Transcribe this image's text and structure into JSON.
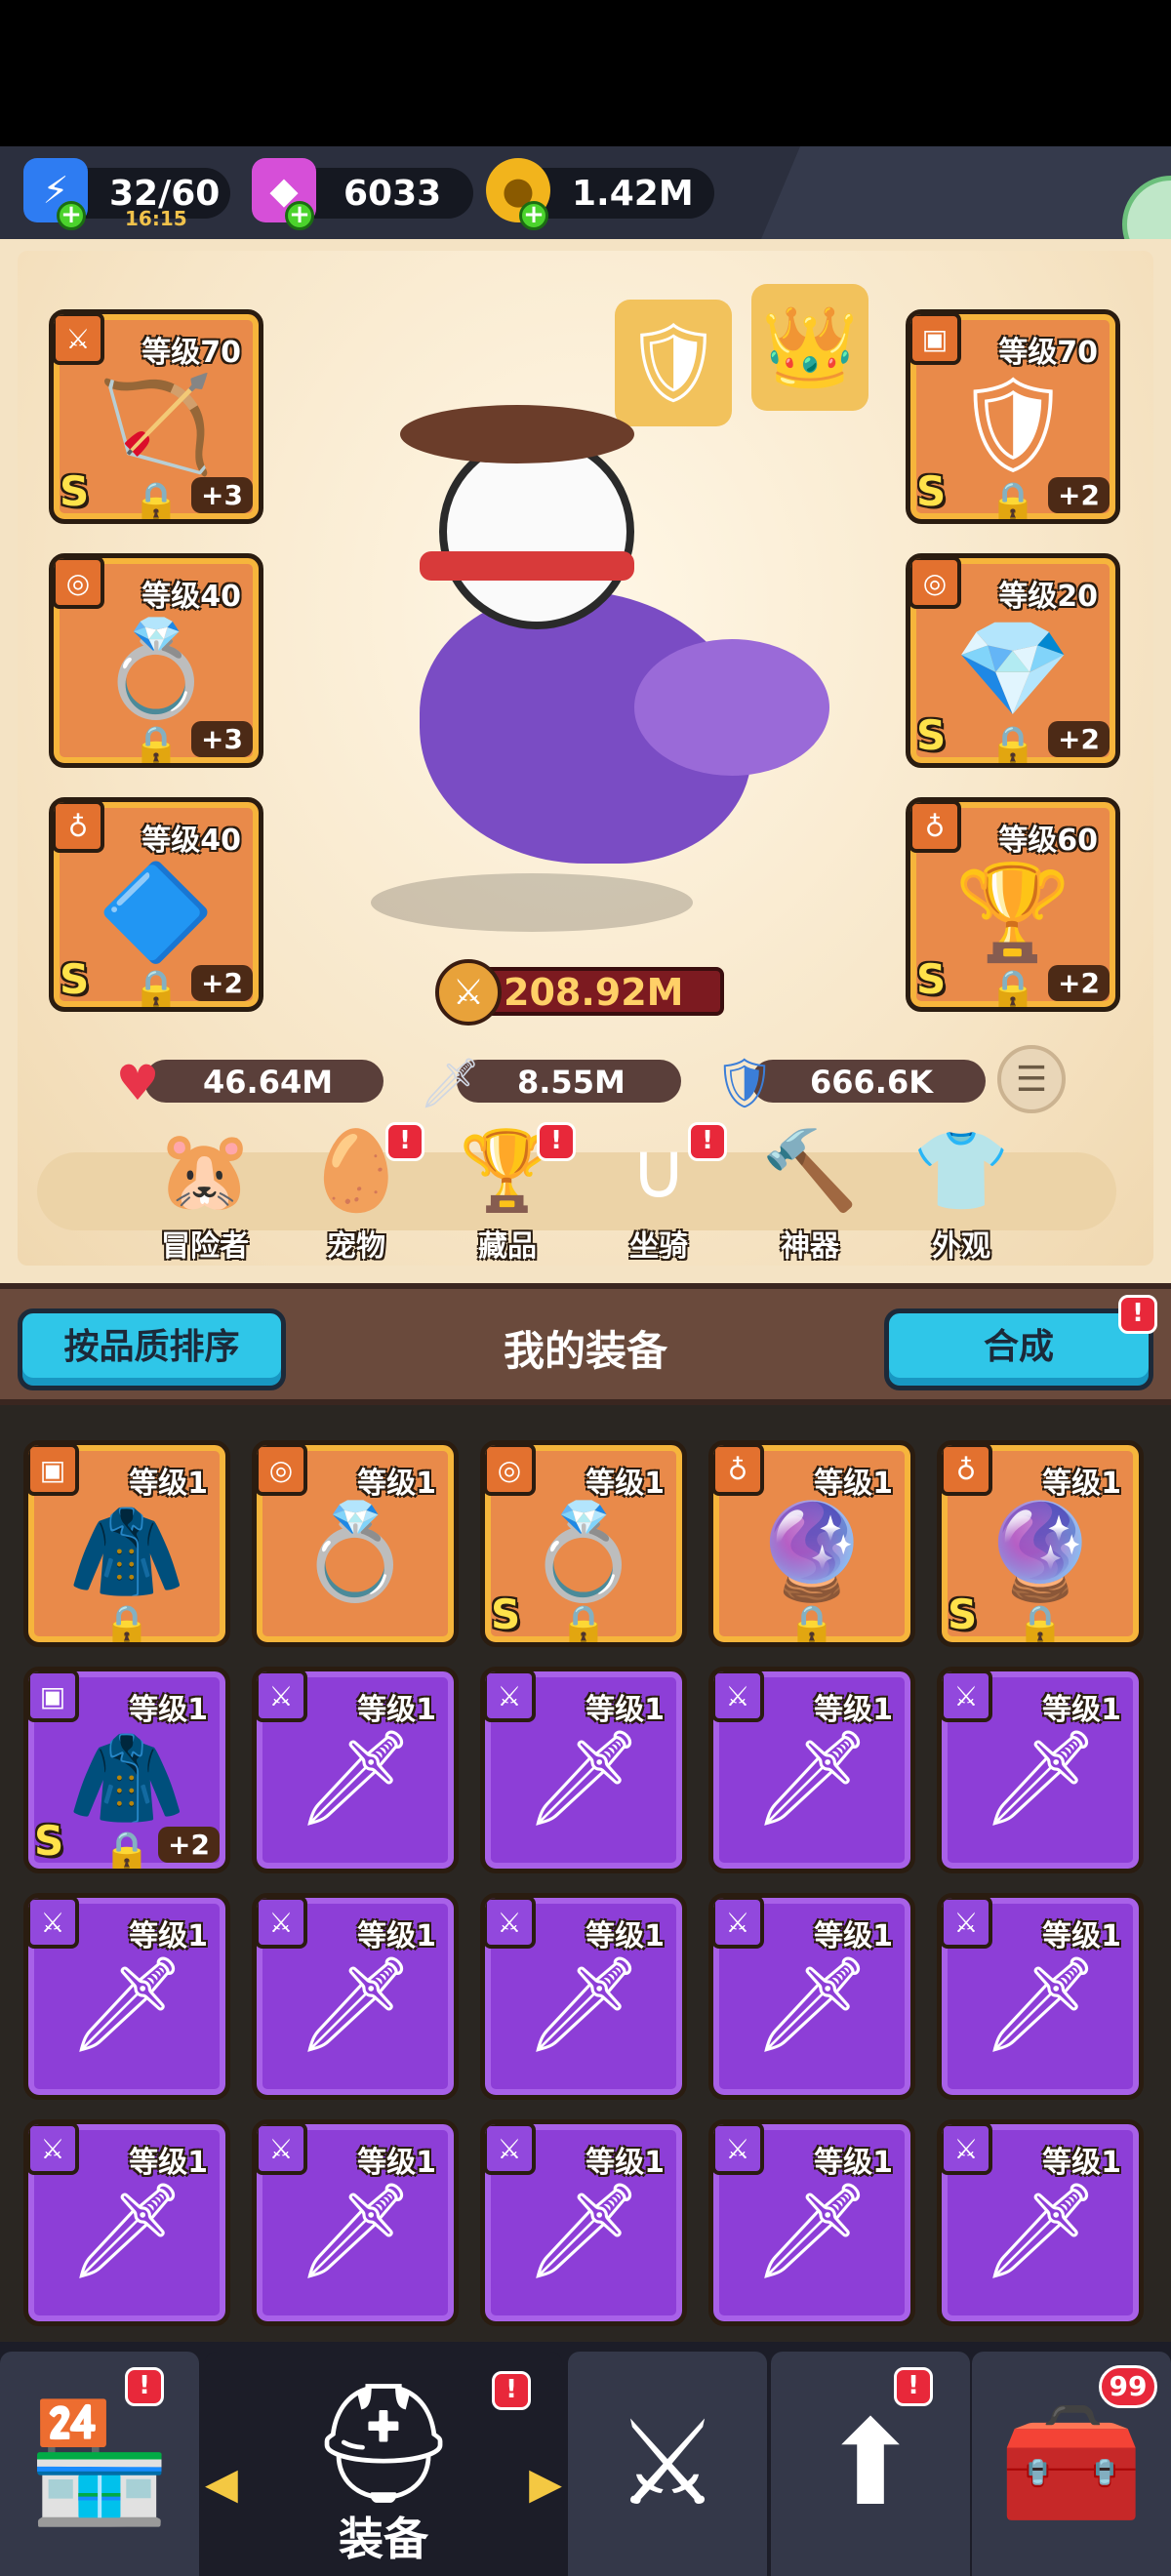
{
  "resources": {
    "energy": {
      "value": "32/60",
      "timer": "16:15",
      "icon": "lightning-icon"
    },
    "gems": {
      "value": "6033",
      "icon": "gem-icon"
    },
    "gold": {
      "value": "1.42M",
      "icon": "coin-icon"
    }
  },
  "equipped_left": [
    {
      "level": "等级70",
      "grade": "S",
      "plus": "+3",
      "slot": "weapon",
      "art": "crossbow"
    },
    {
      "level": "等级40",
      "grade": "",
      "plus": "+3",
      "slot": "ring",
      "art": "ring"
    },
    {
      "level": "等级40",
      "grade": "S",
      "plus": "+2",
      "slot": "amulet",
      "art": "winged-emblem"
    }
  ],
  "equipped_right": [
    {
      "level": "等级70",
      "grade": "S",
      "plus": "+2",
      "slot": "armor",
      "art": "dark-armor"
    },
    {
      "level": "等级20",
      "grade": "S",
      "plus": "+2",
      "slot": "ring",
      "art": "ruby-ring"
    },
    {
      "level": "等级60",
      "grade": "S",
      "plus": "+2",
      "slot": "amulet",
      "art": "chalice"
    }
  ],
  "power": "208.92M",
  "stats": {
    "hp": "46.64M",
    "attack": "8.55M",
    "defense": "666.6K"
  },
  "hero_tabs": [
    {
      "label": "冒险者",
      "badge": false
    },
    {
      "label": "宠物",
      "badge": true
    },
    {
      "label": "藏品",
      "badge": true
    },
    {
      "label": "坐骑",
      "badge": true
    },
    {
      "label": "神器",
      "badge": false
    },
    {
      "label": "外观",
      "badge": false
    }
  ],
  "inventory_header": {
    "sort_button": "按品质排序",
    "title": "我的装备",
    "synth_button": "合成"
  },
  "inventory": [
    {
      "level": "等级1",
      "rarity": "orange",
      "slot": "armor",
      "grade": "",
      "plus": "",
      "locked": true
    },
    {
      "level": "等级1",
      "rarity": "orange",
      "slot": "ring",
      "grade": "",
      "plus": "",
      "locked": false
    },
    {
      "level": "等级1",
      "rarity": "orange",
      "slot": "ring",
      "grade": "S",
      "plus": "",
      "locked": true
    },
    {
      "level": "等级1",
      "rarity": "orange",
      "slot": "amulet",
      "grade": "",
      "plus": "",
      "locked": true
    },
    {
      "level": "等级1",
      "rarity": "orange",
      "slot": "amulet",
      "grade": "S",
      "plus": "",
      "locked": true
    },
    {
      "level": "等级1",
      "rarity": "purple",
      "slot": "armor",
      "grade": "S",
      "plus": "+2",
      "locked": true
    },
    {
      "level": "等级1",
      "rarity": "purple",
      "slot": "weapon",
      "grade": "",
      "plus": "",
      "locked": false
    },
    {
      "level": "等级1",
      "rarity": "purple",
      "slot": "weapon",
      "grade": "",
      "plus": "",
      "locked": false
    },
    {
      "level": "等级1",
      "rarity": "purple",
      "slot": "weapon",
      "grade": "",
      "plus": "",
      "locked": false
    },
    {
      "level": "等级1",
      "rarity": "purple",
      "slot": "weapon",
      "grade": "",
      "plus": "",
      "locked": false
    },
    {
      "level": "等级1",
      "rarity": "purple",
      "slot": "weapon",
      "grade": "",
      "plus": "",
      "locked": false
    },
    {
      "level": "等级1",
      "rarity": "purple",
      "slot": "weapon",
      "grade": "",
      "plus": "",
      "locked": false
    },
    {
      "level": "等级1",
      "rarity": "purple",
      "slot": "weapon",
      "grade": "",
      "plus": "",
      "locked": false
    },
    {
      "level": "等级1",
      "rarity": "purple",
      "slot": "weapon",
      "grade": "",
      "plus": "",
      "locked": false
    },
    {
      "level": "等级1",
      "rarity": "purple",
      "slot": "weapon",
      "grade": "",
      "plus": "",
      "locked": false
    },
    {
      "level": "等级1",
      "rarity": "purple",
      "slot": "weapon",
      "grade": "",
      "plus": "",
      "locked": false
    },
    {
      "level": "等级1",
      "rarity": "purple",
      "slot": "weapon",
      "grade": "",
      "plus": "",
      "locked": false
    },
    {
      "level": "等级1",
      "rarity": "purple",
      "slot": "weapon",
      "grade": "",
      "plus": "",
      "locked": false
    },
    {
      "level": "等级1",
      "rarity": "purple",
      "slot": "weapon",
      "grade": "",
      "plus": "",
      "locked": false
    },
    {
      "level": "等级1",
      "rarity": "purple",
      "slot": "weapon",
      "grade": "",
      "plus": "",
      "locked": false
    }
  ],
  "navbar": {
    "items": [
      {
        "name": "shop",
        "icon": "shop-icon",
        "badge": true
      },
      {
        "name": "equipment",
        "icon": "helmet-icon",
        "label": "装备",
        "badge": true,
        "active": true
      },
      {
        "name": "battle",
        "icon": "crossed-swords-icon",
        "badge": false
      },
      {
        "name": "upgrade",
        "icon": "upgrade-icon",
        "badge": true
      },
      {
        "name": "chest",
        "icon": "chest-icon",
        "count": "99"
      }
    ]
  },
  "colors": {
    "orange_card": "#e98a4a",
    "purple_card": "#8d3ed7",
    "accent_blue": "#2fc6e8",
    "badge_red": "#e8283a"
  }
}
